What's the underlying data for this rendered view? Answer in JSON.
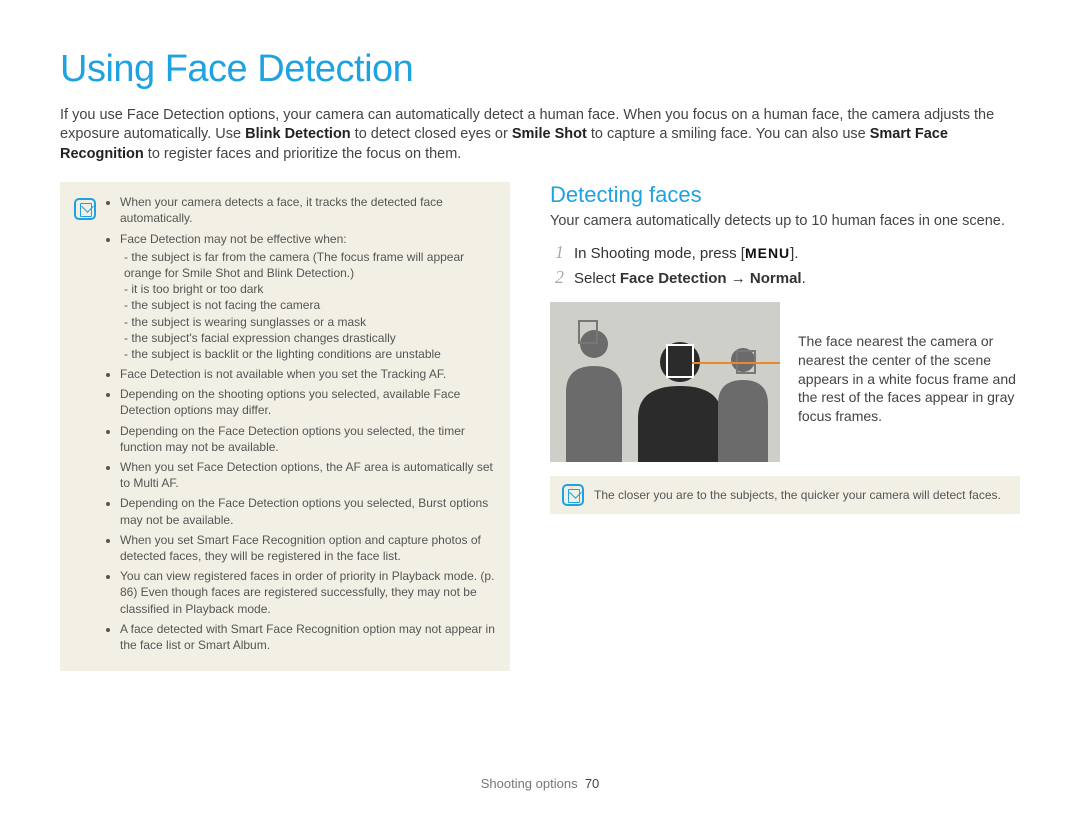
{
  "title": "Using Face Detection",
  "intro_parts": {
    "a": "If you use Face Detection options, your camera can automatically detect a human face. When you focus on a human face, the camera adjusts the exposure automatically. Use ",
    "b1": "Blink Detection",
    "c": " to detect closed eyes or ",
    "b2": "Smile Shot",
    "d": " to capture a smiling face. You can also use ",
    "b3": "Smart Face Recognition",
    "e": " to register faces and prioritize the focus on them."
  },
  "notes_left": {
    "items": [
      "When your camera detects a face, it tracks the detected face automatically.",
      "Face Detection may not be effective when:"
    ],
    "sub_items": [
      "the subject is far from the camera (The focus frame will appear orange for Smile Shot and Blink Detection.)",
      "it is too bright or too dark",
      "the subject is not facing the camera",
      "the subject is wearing sunglasses or a mask",
      "the subject's facial expression changes drastically",
      "the subject is backlit or the lighting conditions are unstable"
    ],
    "items2": [
      "Face Detection is not available when you set the Tracking AF.",
      "Depending on the shooting options you selected, available Face Detection options may differ.",
      "Depending on the Face Detection options you selected, the timer function may not be available.",
      "When you set Face Detection options, the AF area is automatically set to Multi AF.",
      "Depending on the Face Detection options you selected, Burst options may not be available.",
      "When you set Smart Face Recognition option and capture photos of detected faces, they will be registered in the face list.",
      "You can view registered faces in order of priority in Playback mode. (p. 86) Even though faces are registered successfully, they may not be classified in Playback mode.",
      "A face detected with Smart Face Recognition option may not appear in the face list or Smart Album."
    ]
  },
  "right": {
    "heading": "Detecting faces",
    "desc": "Your camera automatically detects up to 10 human faces in one scene.",
    "steps": {
      "s1_pre": "In Shooting mode, press [",
      "s1_key": "MENU",
      "s1_post": "].",
      "s2_pre": "Select ",
      "s2_b": "Face Detection → Normal",
      "s2_post": "."
    },
    "caption": "The face nearest the camera or nearest the center of the scene appears in a white focus frame and the rest of the faces appear in gray focus frames.",
    "tip": "The closer you are to the subjects, the quicker your camera will detect faces."
  },
  "footer": {
    "section": "Shooting options",
    "page": "70"
  }
}
